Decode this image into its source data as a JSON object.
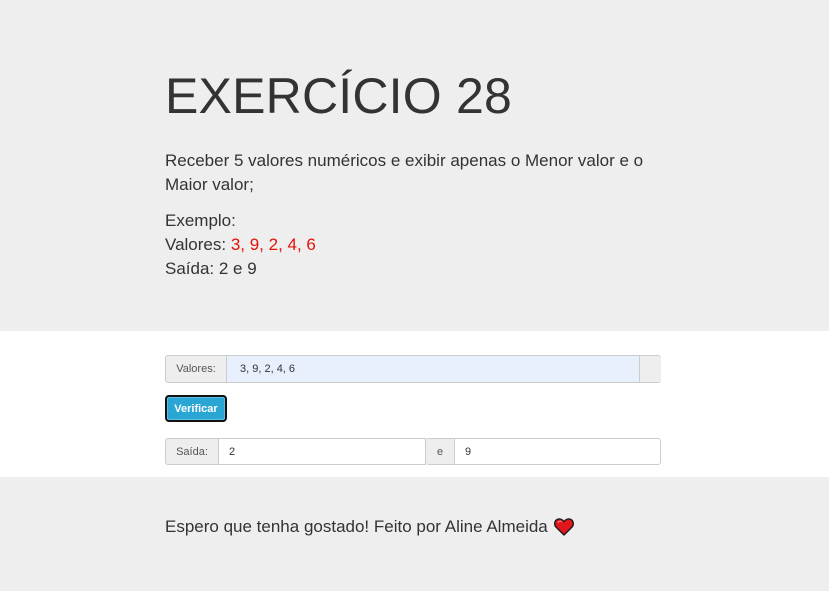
{
  "header": {
    "title": "EXERCÍCIO 28",
    "description": "Receber 5 valores numéricos e exibir apenas o Menor valor e o Maior valor;",
    "example_label": "Exemplo:",
    "values_label": "Valores: ",
    "values_example": "3, 9, 2, 4, 6",
    "output_example": "Saída: 2 e 9"
  },
  "form": {
    "values_addon": "Valores:",
    "values_input": "3, 9, 2, 4, 6",
    "verify_button": "Verificar",
    "output_addon": "Saída:",
    "min_output": "2",
    "separator": "e",
    "max_output": "9"
  },
  "footer": {
    "text": "Espero que tenha gostado! Feito por Aline Almeida",
    "icon": "heart-icon"
  },
  "colors": {
    "highlight": "#e3120b",
    "button": "#2aa6d4",
    "input_autofill": "#e8f0fe"
  }
}
